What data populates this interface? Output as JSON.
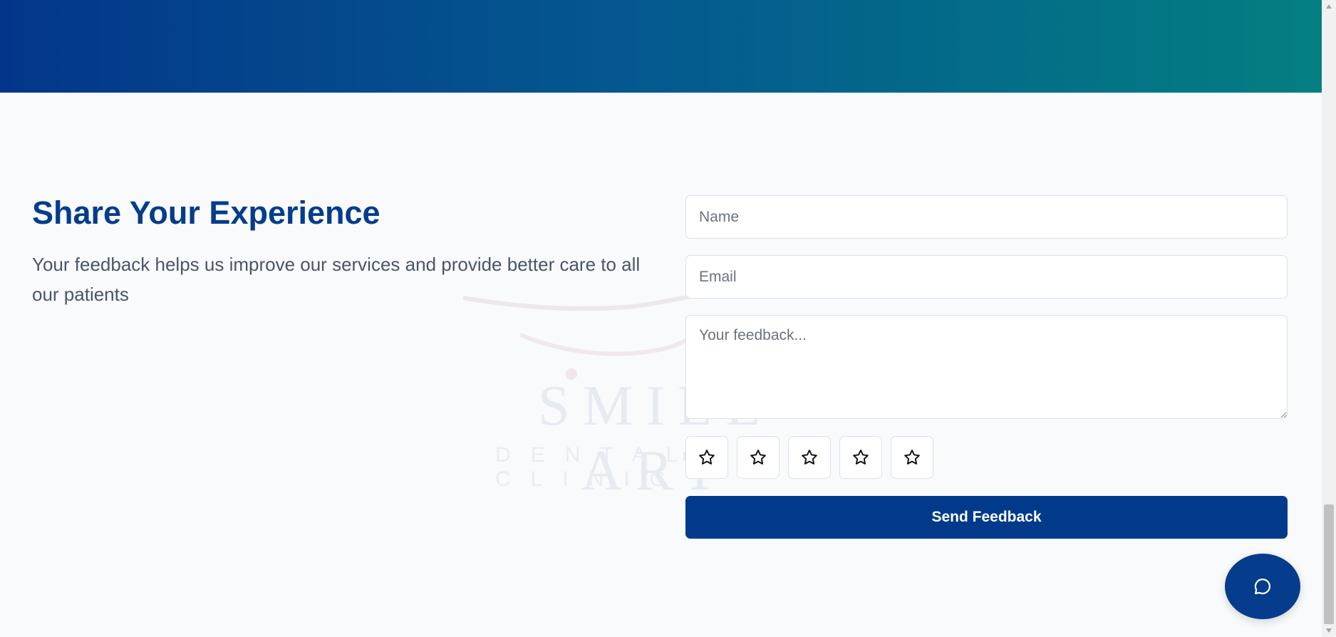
{
  "watermark": {
    "logo_text": "SMILE ART",
    "logo_subtext": "DENTAL CLINIC"
  },
  "feedback": {
    "title": "Share Your Experience",
    "subtitle": "Your feedback helps us improve our services and provide better care to all our patients",
    "name_placeholder": "Name",
    "email_placeholder": "Email",
    "feedback_placeholder": "Your feedback...",
    "rating": {
      "max": 5,
      "selected": 0,
      "icon": "star-outline-icon"
    },
    "submit_label": "Send Feedback"
  },
  "chat": {
    "icon": "chat-bubble-icon"
  },
  "colors": {
    "primary": "#053c8c",
    "button": "#013a8b",
    "gradient_start": "#03368a",
    "gradient_end": "#037f81",
    "background": "#f8fafc"
  }
}
